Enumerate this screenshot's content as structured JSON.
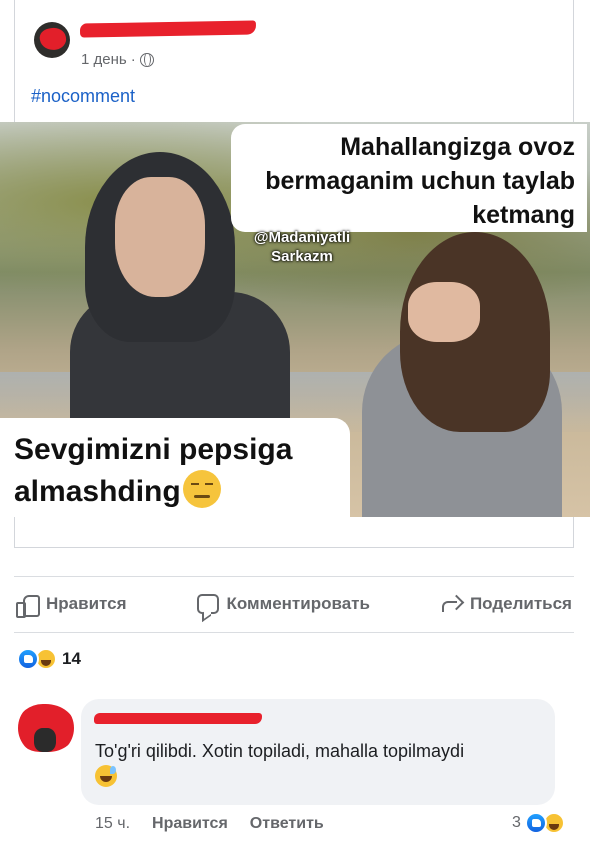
{
  "post": {
    "timestamp": "1 день",
    "separator": "·",
    "hashtag": "#nocomment"
  },
  "image": {
    "caption_top": "Mahallangizga ovoz bermaganim uchun taylab ketmang",
    "caption_bottom": "Sevgimizni pepsiga almashding",
    "watermark": "@Madaniyatli Sarkazm"
  },
  "actions": {
    "like_label": "Нравится",
    "comment_label": "Комментировать",
    "share_label": "Поделиться"
  },
  "reactions": {
    "count": "14"
  },
  "comment": {
    "text": "To'g'ri qilibdi. Xotin topiladi, mahalla topilmaydi",
    "time": "15 ч.",
    "like_label": "Нравится",
    "reply_label": "Ответить",
    "reaction_count": "3"
  },
  "colors": {
    "link": "#1b61c7",
    "muted": "#65676b",
    "redaction": "#e8212c",
    "bubble": "#f0f2f5"
  }
}
